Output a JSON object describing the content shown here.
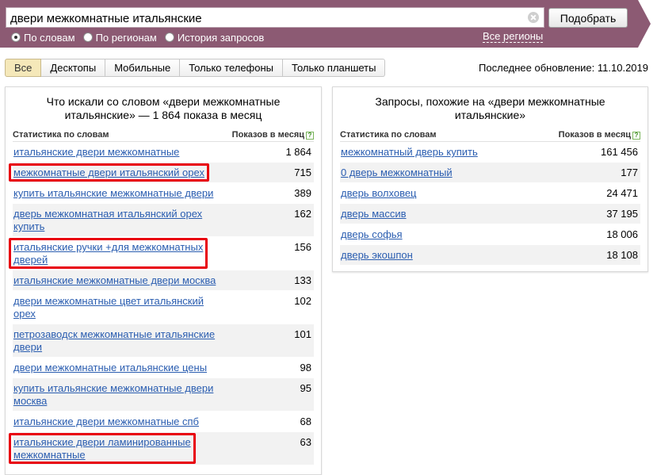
{
  "search": {
    "query": "двери межкомнатные итальянские",
    "submit_label": "Подобрать",
    "modes": [
      {
        "label": "По словам",
        "checked": true
      },
      {
        "label": "По регионам",
        "checked": false
      },
      {
        "label": "История запросов",
        "checked": false
      }
    ],
    "regions_link": "Все регионы"
  },
  "tabs": [
    {
      "label": "Все",
      "active": true
    },
    {
      "label": "Десктопы",
      "active": false
    },
    {
      "label": "Мобильные",
      "active": false
    },
    {
      "label": "Только телефоны",
      "active": false
    },
    {
      "label": "Только планшеты",
      "active": false
    }
  ],
  "last_update": "Последнее обновление: 11.10.2019",
  "left_panel": {
    "title": "Что искали со словом «двери межкомнатные итальянские» — 1 864 показа в месяц",
    "col_keyword": "Статистика по словам",
    "col_count": "Показов в месяц",
    "help": "?",
    "rows": [
      {
        "keyword": "итальянские двери межкомнатные",
        "count": "1 864",
        "lines": 1,
        "highlight": false
      },
      {
        "keyword": "межкомнатные двери итальянский орех",
        "count": "715",
        "lines": 1,
        "highlight": true
      },
      {
        "keyword": "купить итальянские межкомнатные двери",
        "count": "389",
        "lines": 1,
        "highlight": false
      },
      {
        "keyword": "дверь межкомнатная итальянский орех купить",
        "count": "162",
        "lines": 2,
        "highlight": false
      },
      {
        "keyword": "итальянские ручки +для межкомнатных дверей",
        "count": "156",
        "lines": 2,
        "highlight": true
      },
      {
        "keyword": "итальянские межкомнатные двери москва",
        "count": "133",
        "lines": 1,
        "highlight": false
      },
      {
        "keyword": "двери межкомнатные цвет итальянский орех",
        "count": "102",
        "lines": 2,
        "highlight": false
      },
      {
        "keyword": "петрозаводск межкомнатные итальянские двери",
        "count": "101",
        "lines": 2,
        "highlight": false
      },
      {
        "keyword": "двери межкомнатные итальянские цены",
        "count": "98",
        "lines": 1,
        "highlight": false
      },
      {
        "keyword": "купить итальянские межкомнатные двери москва",
        "count": "95",
        "lines": 2,
        "highlight": false
      },
      {
        "keyword": "итальянские двери межкомнатные спб",
        "count": "68",
        "lines": 1,
        "highlight": false
      },
      {
        "keyword": "итальянские двери ламинированные межкомнатные",
        "count": "63",
        "lines": 2,
        "highlight": true
      }
    ]
  },
  "right_panel": {
    "title": "Запросы, похожие на «двери межкомнатные итальянские»",
    "col_keyword": "Статистика по словам",
    "col_count": "Показов в месяц",
    "help": "?",
    "rows": [
      {
        "keyword": "межкомнатный дверь купить",
        "count": "161 456"
      },
      {
        "keyword": "0 дверь межкомнатный",
        "count": "177"
      },
      {
        "keyword": "дверь волховец",
        "count": "24 471"
      },
      {
        "keyword": "дверь массив",
        "count": "37 195"
      },
      {
        "keyword": "дверь софья",
        "count": "18 006"
      },
      {
        "keyword": "дверь экошпон",
        "count": "18 108"
      }
    ]
  },
  "colors": {
    "header_bg": "#8c5a73",
    "link": "#2a5db0",
    "highlight": "#e8000e",
    "active_tab": "#f5e8b9",
    "alt_row": "#f2f2f2"
  }
}
